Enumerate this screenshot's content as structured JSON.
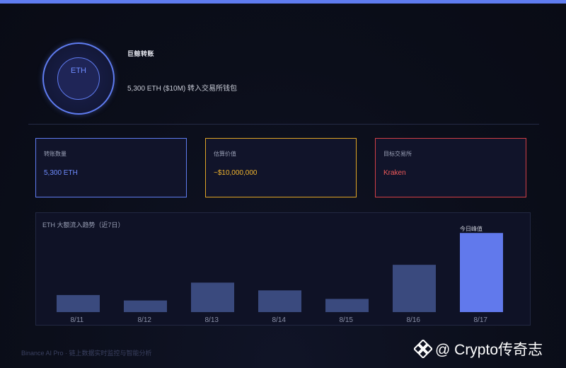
{
  "header": {
    "token": "ETH",
    "headline": "巨鲸转账",
    "subline": "5,300 ETH ($10M) 转入交易所钱包"
  },
  "stats": [
    {
      "label": "转账数量",
      "value": "5,300 ETH"
    },
    {
      "label": "估算价值",
      "value": "~$10,000,000"
    },
    {
      "label": "目标交易所",
      "value": "Kraken"
    }
  ],
  "chart": {
    "title": "ETH 大额流入趋势（近7日）",
    "peak_label": "今日峰值"
  },
  "chart_data": {
    "type": "bar",
    "categories": [
      "8/11",
      "8/12",
      "8/13",
      "8/14",
      "8/15",
      "8/16",
      "8/17"
    ],
    "values": [
      22,
      15,
      38,
      28,
      17,
      61,
      102
    ],
    "highlight_index": 6,
    "ylim": [
      0,
      115
    ],
    "grid": false,
    "colors": {
      "normal": "#3a4a7e",
      "highlight": "#6179ec"
    }
  },
  "footer": {
    "note": "Binance AI Pro · 链上数据实时监控与智能分析",
    "watermark": "@ Crypto传奇志"
  }
}
